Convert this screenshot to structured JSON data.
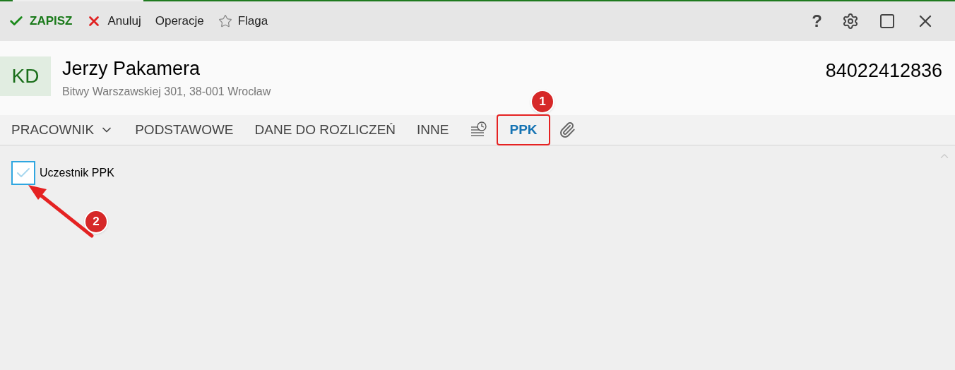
{
  "toolbar": {
    "actions": [
      {
        "kind": "save",
        "label": "ZAPISZ"
      },
      {
        "kind": "cancel",
        "label": "Anuluj"
      },
      {
        "kind": "plain",
        "label": "Operacje"
      },
      {
        "kind": "flag",
        "label": "Flaga"
      }
    ],
    "window_controls": [
      {
        "kind": "help",
        "label": "?"
      },
      {
        "kind": "settings"
      },
      {
        "kind": "maximize"
      },
      {
        "kind": "close"
      }
    ]
  },
  "header": {
    "initials": "KD",
    "name": "Jerzy Pakamera",
    "address": "Bitwy Warszawskiej 301, 38-001 Wrocław",
    "number": "84022412836"
  },
  "tabs": [
    {
      "kind": "dropdown",
      "label": "PRACOWNIK",
      "selected": false,
      "highlighted": false
    },
    {
      "kind": "text",
      "label": "PODSTAWOWE",
      "selected": false,
      "highlighted": false
    },
    {
      "kind": "text",
      "label": "DANE DO ROZLICZEŃ",
      "selected": false,
      "highlighted": false
    },
    {
      "kind": "text",
      "label": "INNE",
      "selected": false,
      "highlighted": false
    },
    {
      "kind": "history",
      "selected": false,
      "highlighted": false
    },
    {
      "kind": "text",
      "label": "PPK",
      "selected": true,
      "highlighted": true
    },
    {
      "kind": "attachment",
      "selected": false,
      "highlighted": false
    }
  ],
  "content": {
    "checkbox": {
      "label": "Uczestnik PPK",
      "checked": true
    }
  },
  "annotations": [
    {
      "label": "1"
    },
    {
      "label": "2"
    }
  ]
}
